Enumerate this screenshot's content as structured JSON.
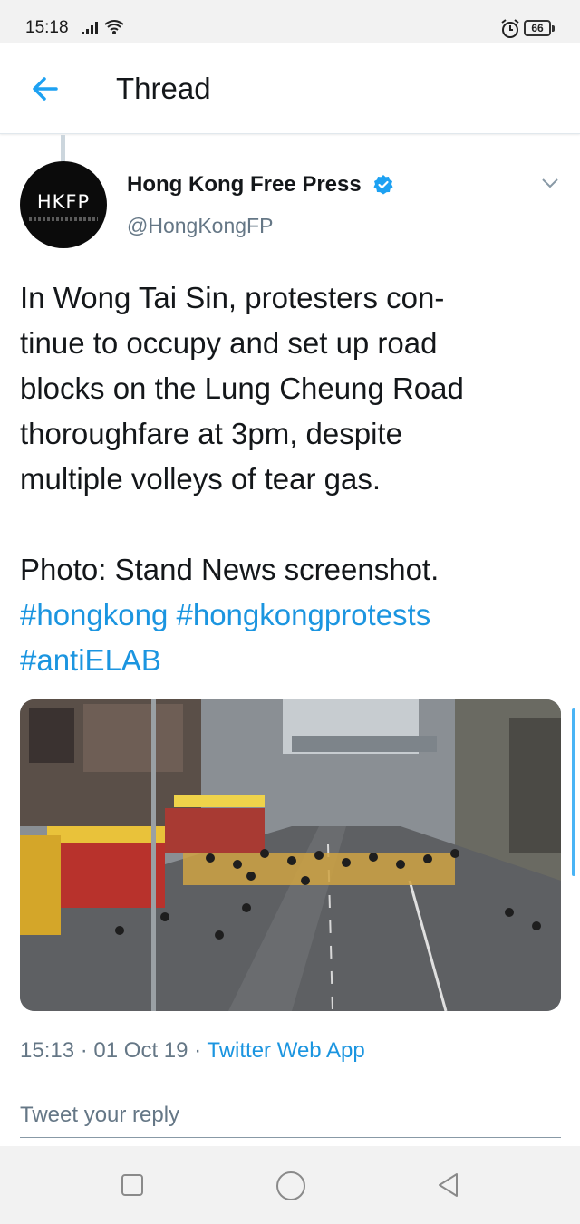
{
  "status_bar": {
    "time": "15:18",
    "battery": "66",
    "icons": [
      "signal-icon",
      "wifi-icon",
      "alarm-icon",
      "battery-icon"
    ]
  },
  "header": {
    "title": "Thread",
    "back_icon": "back-arrow-icon"
  },
  "tweet": {
    "avatar_text": "HKFP",
    "author_name": "Hong Kong Free Press",
    "author_handle": "@HongKongFP",
    "verified_icon": "verified-badge-icon",
    "menu_icon": "chevron-down-icon",
    "text_lines": [
      "In Wong Tai Sin, protesters con-",
      "tinue to occupy and set up road",
      "blocks on the Lung Cheung Road",
      "thoroughfare at 3pm, despite",
      "multiple volleys of tear gas."
    ],
    "photo_line": "Photo: Stand News screenshot.",
    "hashtags": [
      "#hongkong",
      "#hongkongprotests",
      "#antiELAB"
    ],
    "time": "15:13",
    "separator": "·",
    "date": "01 Oct 19",
    "source": "Twitter Web App"
  },
  "reply": {
    "placeholder": "Tweet your reply"
  },
  "nav_bar": {
    "icons": [
      "recents-square-icon",
      "home-circle-icon",
      "back-triangle-icon"
    ]
  },
  "colors": {
    "link": "#1b95e0",
    "text": "#14171a",
    "secondary": "#657786",
    "verified": "#1da1f2"
  }
}
